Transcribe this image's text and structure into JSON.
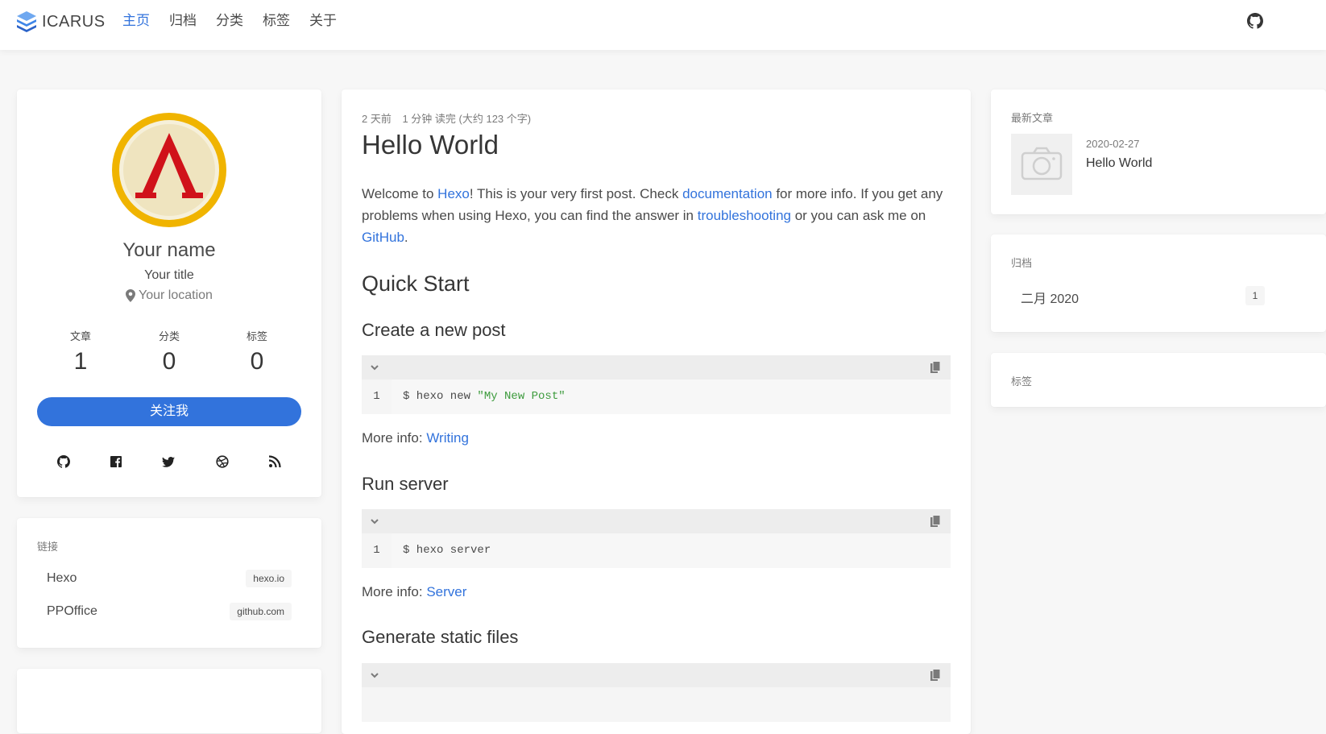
{
  "navbar": {
    "brand": "ICARUS",
    "items": [
      {
        "label": "主页",
        "active": true
      },
      {
        "label": "归档",
        "active": false
      },
      {
        "label": "分类",
        "active": false
      },
      {
        "label": "标签",
        "active": false
      },
      {
        "label": "关于",
        "active": false
      }
    ],
    "github_icon": "github-icon"
  },
  "profile": {
    "name": "Your name",
    "title": "Your title",
    "location": "Your location",
    "stats": [
      {
        "label": "文章",
        "value": "1"
      },
      {
        "label": "分类",
        "value": "0"
      },
      {
        "label": "标签",
        "value": "0"
      }
    ],
    "follow_label": "关注我",
    "social_icons": [
      "github-icon",
      "facebook-icon",
      "twitter-icon",
      "dribbble-icon",
      "rss-icon"
    ]
  },
  "links": {
    "title": "链接",
    "items": [
      {
        "name": "Hexo",
        "host": "hexo.io"
      },
      {
        "name": "PPOffice",
        "host": "github.com"
      }
    ]
  },
  "article": {
    "date": "2 天前",
    "read_time": "1 分钟 读完 (大约 123 个字)",
    "title": "Hello World",
    "intro": {
      "t1": "Welcome to ",
      "l1": "Hexo",
      "t2": "! This is your very first post. Check ",
      "l2": "documentation",
      "t3": " for more info. If you get any problems when using Hexo, you can find the answer in ",
      "l3": "troubleshooting",
      "t4": " or you can ask me on ",
      "l4": "GitHub",
      "t5": "."
    },
    "quick_start": "Quick Start",
    "sections": [
      {
        "heading": "Create a new post",
        "line_no": "1",
        "code_cmd": "$ hexo new ",
        "code_str": "\"My New Post\"",
        "more_label": "More info: ",
        "more_link": "Writing"
      },
      {
        "heading": "Run server",
        "line_no": "1",
        "code_cmd": "$ hexo server",
        "code_str": "",
        "more_label": "More info: ",
        "more_link": "Server"
      },
      {
        "heading": "Generate static files"
      }
    ]
  },
  "recent": {
    "title": "最新文章",
    "items": [
      {
        "date": "2020-02-27",
        "title": "Hello World"
      }
    ]
  },
  "archives": {
    "title": "归档",
    "items": [
      {
        "label": "二月 2020",
        "count": "1"
      }
    ]
  },
  "tags": {
    "title": "标签"
  },
  "colors": {
    "accent": "#3273dc",
    "string": "#3d9b3d",
    "avatar_ring": "#f0b400",
    "avatar_mark": "#d0121a"
  }
}
